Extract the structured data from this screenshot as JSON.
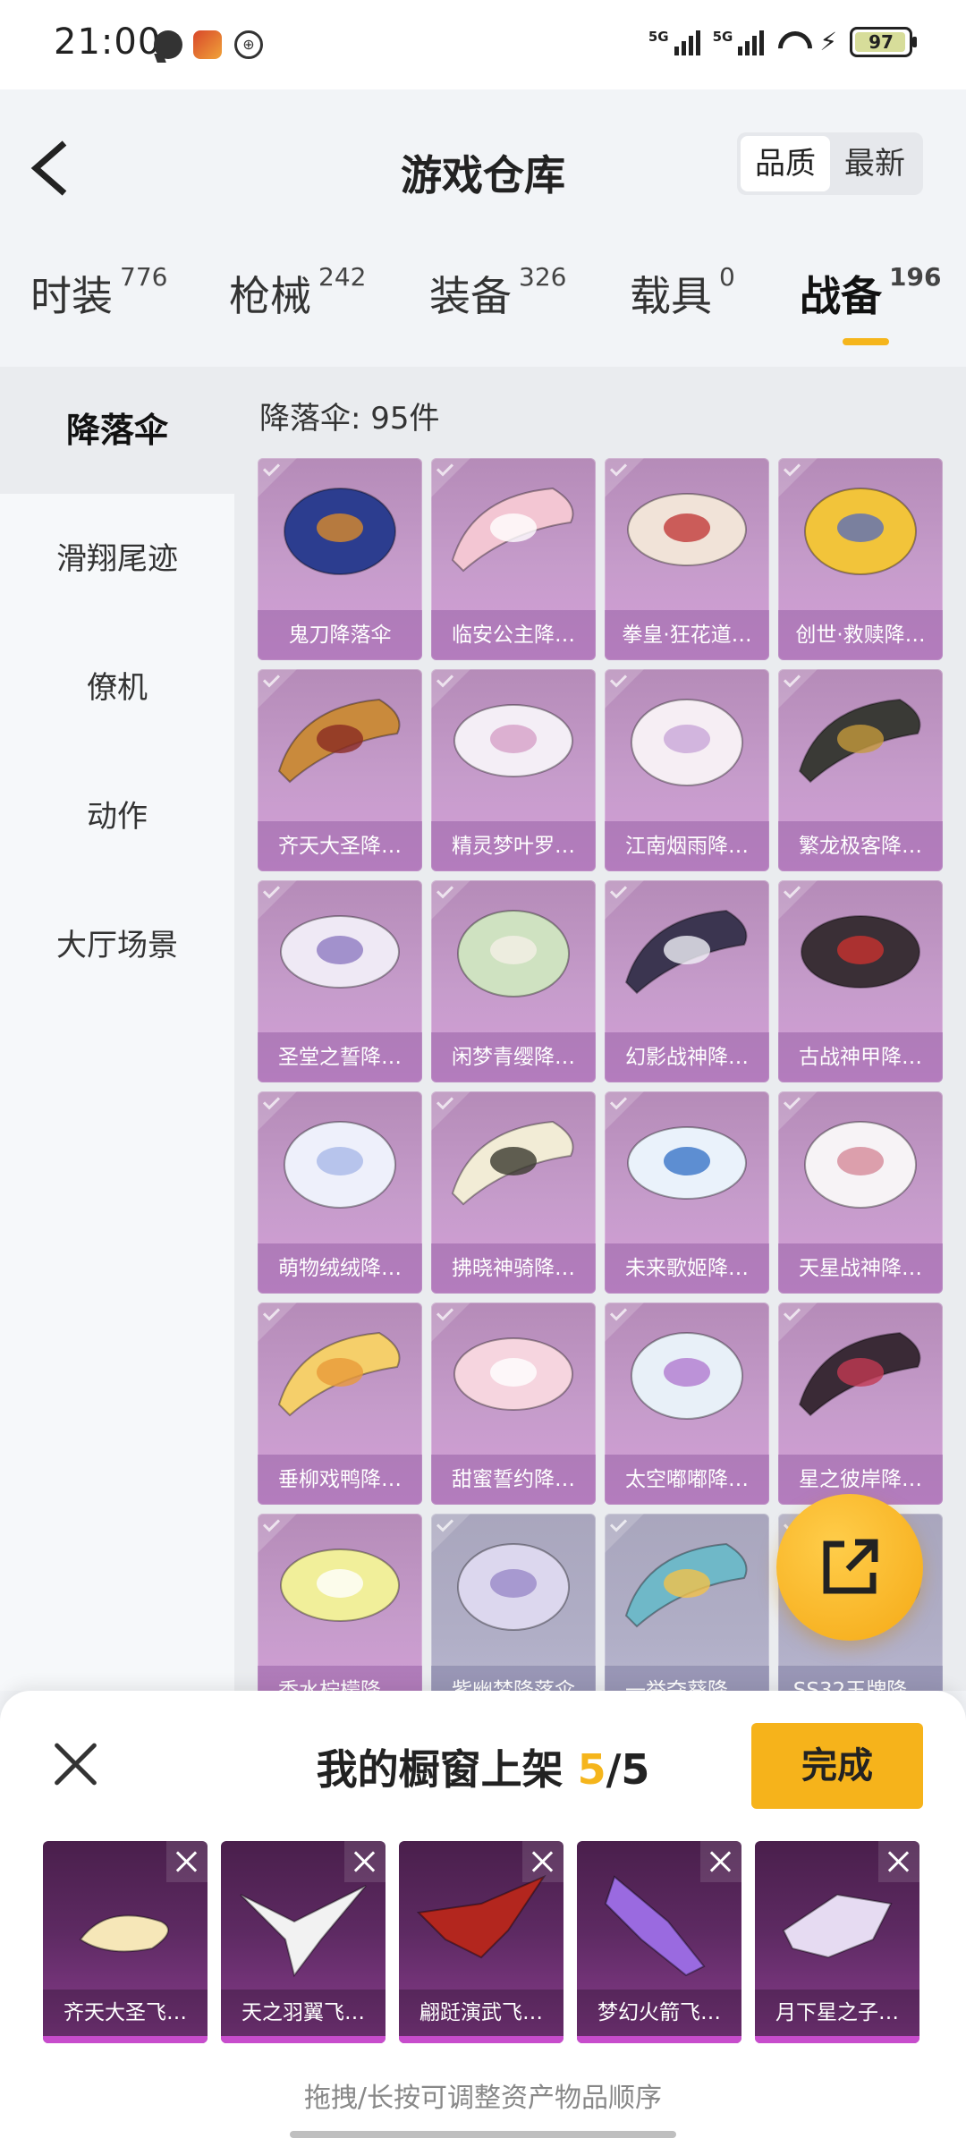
{
  "status_bar": {
    "time": "21:00",
    "battery": "97",
    "sig1": "5G",
    "sig2": "5G"
  },
  "header": {
    "title": "游戏仓库",
    "sort_options": [
      "品质",
      "最新"
    ],
    "tabs": [
      {
        "label": "时装",
        "count": "776"
      },
      {
        "label": "枪械",
        "count": "242"
      },
      {
        "label": "装备",
        "count": "326"
      },
      {
        "label": "载具",
        "count": "0"
      },
      {
        "label": "战备",
        "count": "196"
      }
    ]
  },
  "categories": [
    "降落伞",
    "滑翔尾迹",
    "僚机",
    "动作",
    "大厅场景"
  ],
  "grid": {
    "count_label": "降落伞: 95件",
    "items": [
      {
        "name": "鬼刀降落伞",
        "color": "#2c3d8f",
        "accent": "#d98a2b"
      },
      {
        "name": "临安公主降…",
        "color": "#f3c6d3",
        "accent": "#ffffff"
      },
      {
        "name": "拳皇·狂花道…",
        "color": "#f1e3d8",
        "accent": "#c23a3a"
      },
      {
        "name": "创世·救赎降…",
        "color": "#f2c43a",
        "accent": "#5b6fb8"
      },
      {
        "name": "齐天大圣降…",
        "color": "#c98a3c",
        "accent": "#8a2a22"
      },
      {
        "name": "精灵梦叶罗…",
        "color": "#f4eef6",
        "accent": "#d6a0c8"
      },
      {
        "name": "江南烟雨降…",
        "color": "#f6eef4",
        "accent": "#c9a6d8"
      },
      {
        "name": "繁龙极客降…",
        "color": "#3a3a36",
        "accent": "#c49a3c"
      },
      {
        "name": "圣堂之誓降…",
        "color": "#efe9f5",
        "accent": "#8f7ac2"
      },
      {
        "name": "闲梦青缨降…",
        "color": "#cfe2c1",
        "accent": "#f4f0e6"
      },
      {
        "name": "幻影战神降…",
        "color": "#3b3550",
        "accent": "#f0f0f6"
      },
      {
        "name": "古战神甲降…",
        "color": "#3a2f36",
        "accent": "#c8322f"
      },
      {
        "name": "萌物绒绒降…",
        "color": "#eef0fb",
        "accent": "#a9b9e8"
      },
      {
        "name": "拂晓神骑降…",
        "color": "#f2ecd6",
        "accent": "#3a3a2e"
      },
      {
        "name": "未来歌姬降…",
        "color": "#eaf2fb",
        "accent": "#3a74c8"
      },
      {
        "name": "天星战神降…",
        "color": "#f7f3f6",
        "accent": "#d58a9a"
      },
      {
        "name": "垂柳戏鸭降…",
        "color": "#f5cf6a",
        "accent": "#e89a3a"
      },
      {
        "name": "甜蜜誓约降…",
        "color": "#f6d5df",
        "accent": "#ffffff"
      },
      {
        "name": "太空嘟嘟降…",
        "color": "#e8f0f8",
        "accent": "#b07ad0"
      },
      {
        "name": "星之彼岸降…",
        "color": "#3a2a36",
        "accent": "#c23a52"
      },
      {
        "name": "香水柠檬降…",
        "color": "#f1ef9a",
        "accent": "#ffffff"
      },
      {
        "name": "紫幽梦降落伞",
        "color": "#dcd7ee",
        "accent": "#9a8ac8"
      },
      {
        "name": "一举夺葵降…",
        "color": "#6fb8c8",
        "accent": "#f2c24a"
      },
      {
        "name": "SS32王牌降…",
        "color": "#e7e4f0",
        "accent": "#b8b4d0"
      }
    ]
  },
  "sheet": {
    "title_prefix": "我的橱窗上架",
    "current": "5",
    "total": "/5",
    "done_label": "完成",
    "hint": "拖拽/长按可调整资产物品顺序",
    "slots": [
      {
        "name": "齐天大圣飞…",
        "color": "#f6e7b8"
      },
      {
        "name": "天之羽翼飞…",
        "color": "#f2f2f2"
      },
      {
        "name": "翩跹演武飞…",
        "color": "#b3261e"
      },
      {
        "name": "梦幻火箭飞…",
        "color": "#9a6ae0"
      },
      {
        "name": "月下星之子…",
        "color": "#e6dbf2"
      }
    ]
  }
}
